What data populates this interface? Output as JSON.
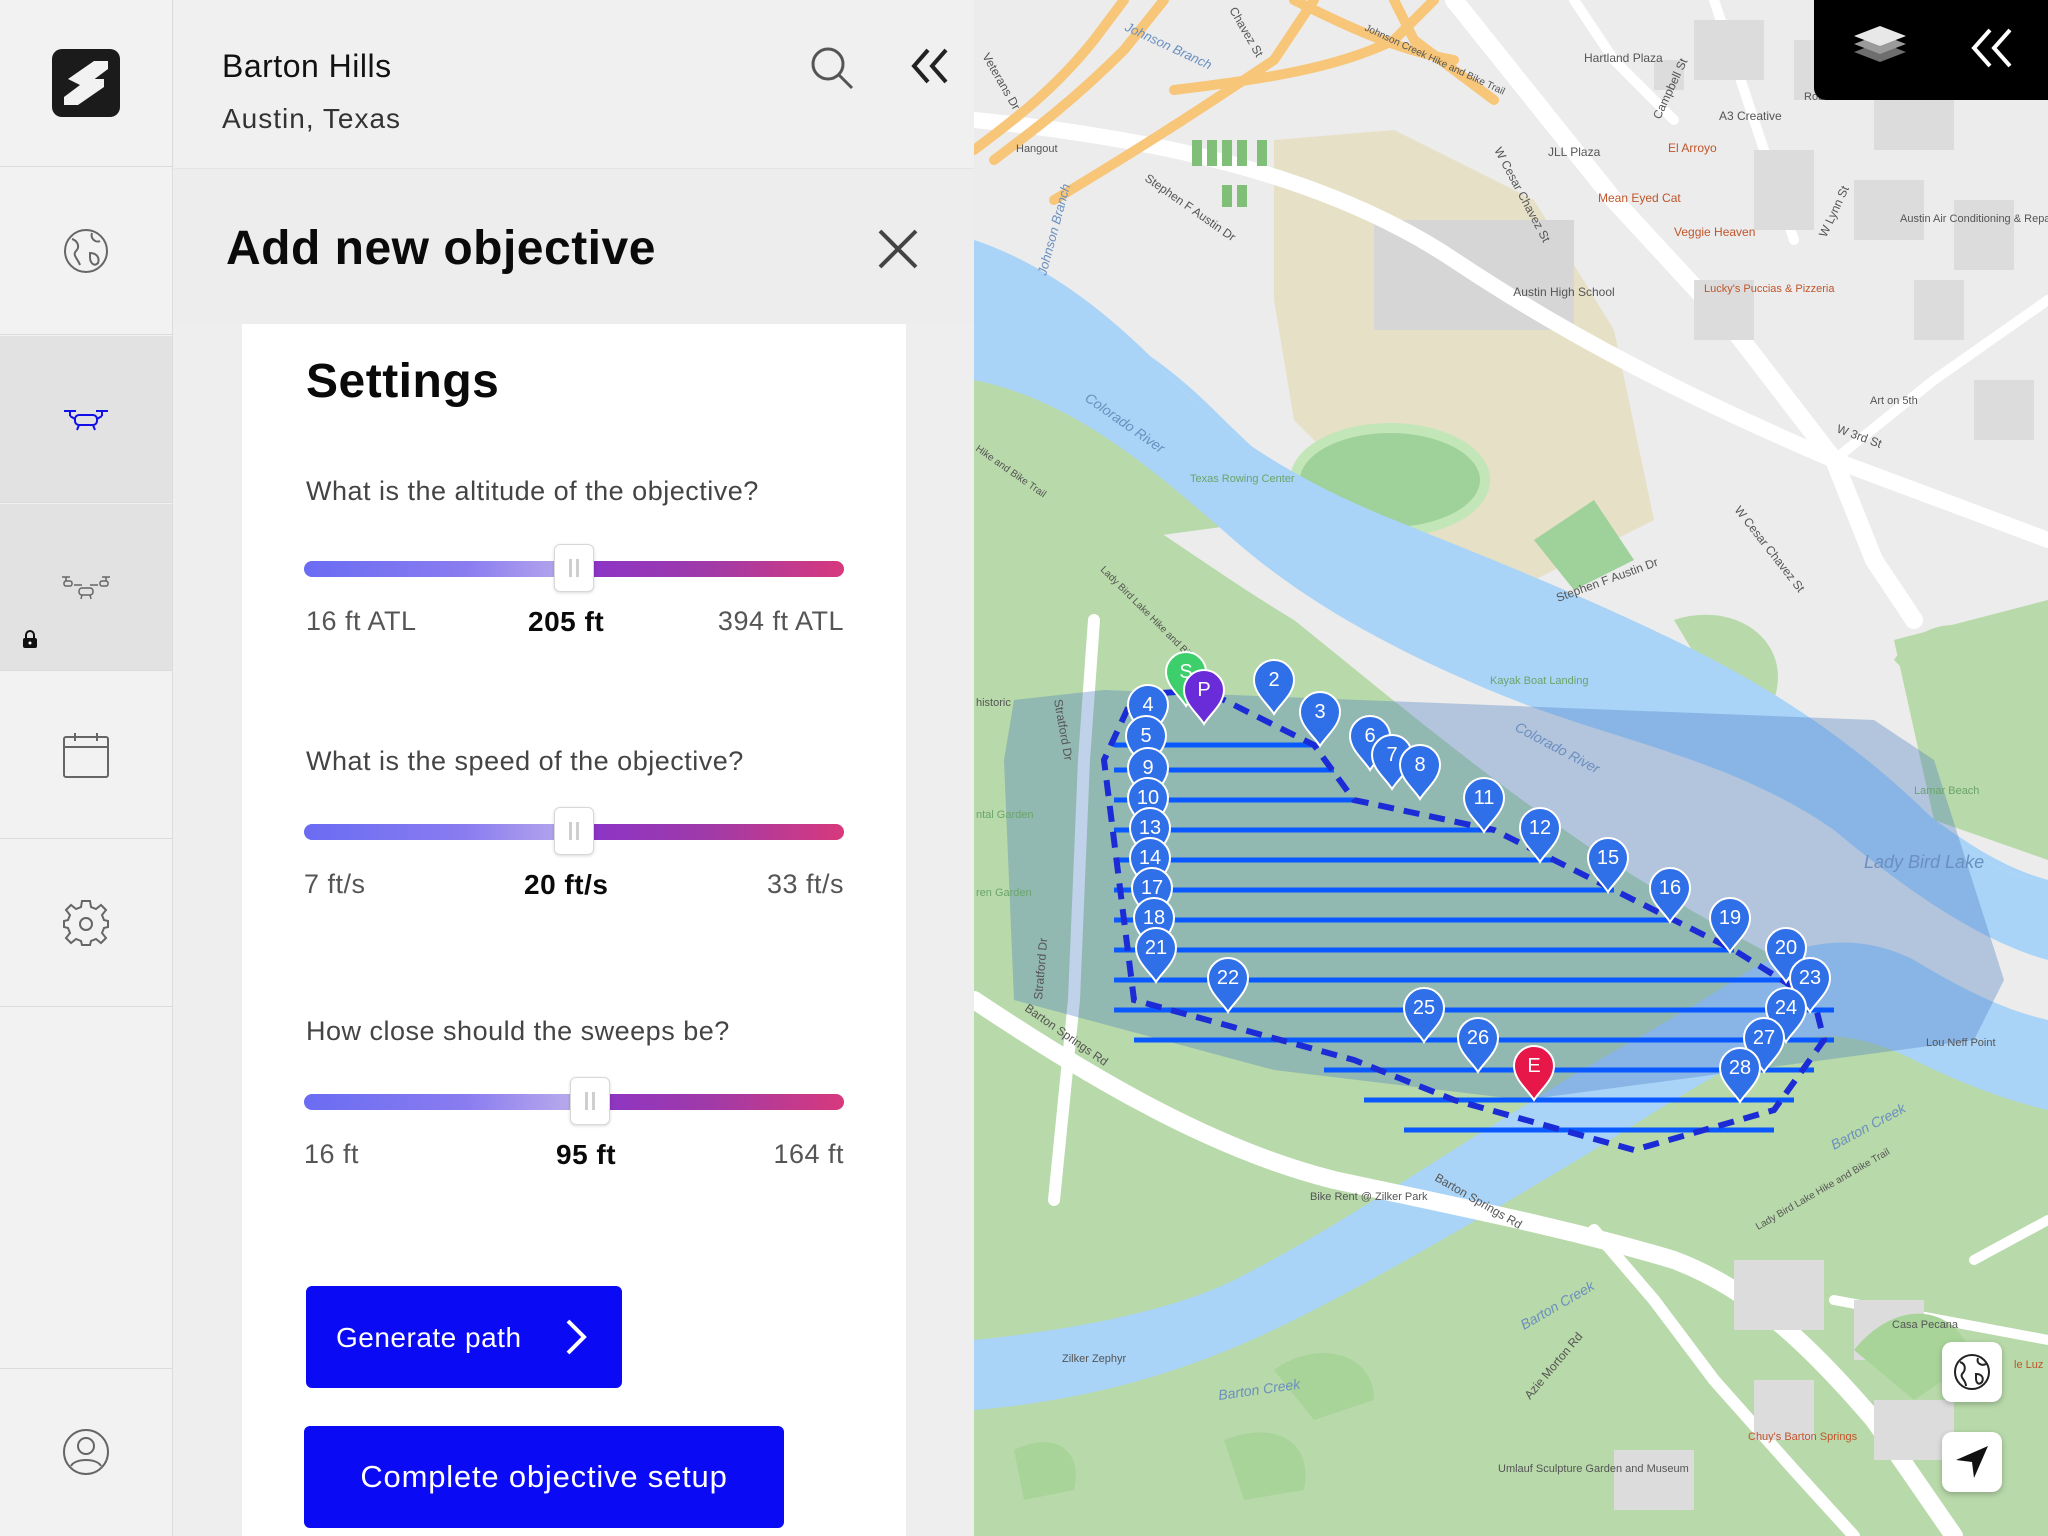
{
  "location": {
    "title": "Barton Hills",
    "subtitle": "Austin, Texas"
  },
  "objective": {
    "title": "Add new objective"
  },
  "settings": {
    "heading": "Settings",
    "altitude": {
      "question": "What is the altitude of the objective?",
      "min": "16 ft ATL",
      "value": "205 ft",
      "max": "394 ft ATL",
      "fraction": 0.5
    },
    "speed": {
      "question": "What is the speed of the objective?",
      "min": "7 ft/s",
      "value": "20 ft/s",
      "max": "33 ft/s",
      "fraction": 0.5
    },
    "sweeps": {
      "question": "How close should the sweeps be?",
      "min": "16 ft",
      "value": "95 ft",
      "max": "164 ft",
      "fraction": 0.53
    }
  },
  "buttons": {
    "generate": "Generate path",
    "complete": "Complete objective setup"
  },
  "nav": [
    "logo",
    "globe-icon",
    "drone-icon",
    "drone-swarm-icon",
    "calendar-icon",
    "gear-icon",
    "user-icon"
  ],
  "map": {
    "labels": {
      "school": "Austin High School",
      "lake": "Lady Bird Lake",
      "river1": "Colorado River",
      "river2": "Colorado River",
      "creek1": "Barton Creek",
      "creek2": "Barton Creek",
      "creek3": "Barton Creek",
      "johnson_branch": "Johnson Branch",
      "johnson_branch2": "Johnson Branch",
      "cesar1": "W Cesar Chavez St",
      "cesar2": "W Cesar Chavez St",
      "chavez": "Chavez St",
      "stephen1": "Stephen F Austin Dr",
      "stephen2": "Stephen F Austin Dr",
      "barton_springs1": "Barton Springs Rd",
      "barton_springs2": "Barton Springs Rd",
      "stratford1": "Stratford Dr",
      "stratford2": "Stratford Dr",
      "azie": "Azie Morton Rd",
      "veterans": "Veterans Dr",
      "campbell": "Campbell St",
      "lynn": "W Lynn St",
      "w3rd": "W 3rd St",
      "trail1": "Johnson Creek Hike and Bike Trail",
      "trail2": "Lady Bird Lake Hike and Bike Trail",
      "trail3": "Lady Bird Lake Hike and Bike Trail",
      "trail4": "Hike and Bike Trail",
      "hartland": "Hartland Plaza",
      "a3": "A3 Creative",
      "robertson": "Robertson House",
      "elarroyo": "El Arroyo",
      "jll": "JLL Plaza",
      "meaneyed": "Mean Eyed Cat",
      "veggie": "Veggie Heaven",
      "luckys": "Lucky's Puccias & Pizzeria",
      "austinair": "Austin Air Conditioning & Repair",
      "art5th": "Art on 5th",
      "hangout": "Hangout",
      "rowing": "Texas Rowing Center",
      "kayak": "Kayak Boat Landing",
      "lamar": "Lamar Beach",
      "louneff": "Lou Neff Point",
      "bikerent": "Bike Rent @ Zilker Park",
      "zephyr": "Zilker Zephyr",
      "umlauf": "Umlauf Sculpture Garden and Museum",
      "casapecana": "Casa Pecana",
      "chuys": "Chuy's Barton Springs",
      "luz": "le Luz",
      "historic": "historic",
      "garden1": "ntal Garden",
      "garden2": "ren Garden"
    },
    "markers": {
      "start": "S",
      "p": "P",
      "end": "E",
      "waypoints": [
        "2",
        "3",
        "4",
        "5",
        "6",
        "7",
        "8",
        "9",
        "10",
        "11",
        "12",
        "13",
        "14",
        "15",
        "16",
        "17",
        "18",
        "19",
        "20",
        "21",
        "22",
        "23",
        "24",
        "25",
        "26",
        "27",
        "28"
      ]
    }
  },
  "colors": {
    "accent": "#0a0af5",
    "water": "#aad3f7",
    "park": "#b6d7a8",
    "path": "#1f47ff",
    "start": "#3ccf6b",
    "end": "#e8174a",
    "marker": "#2f6fe8"
  }
}
